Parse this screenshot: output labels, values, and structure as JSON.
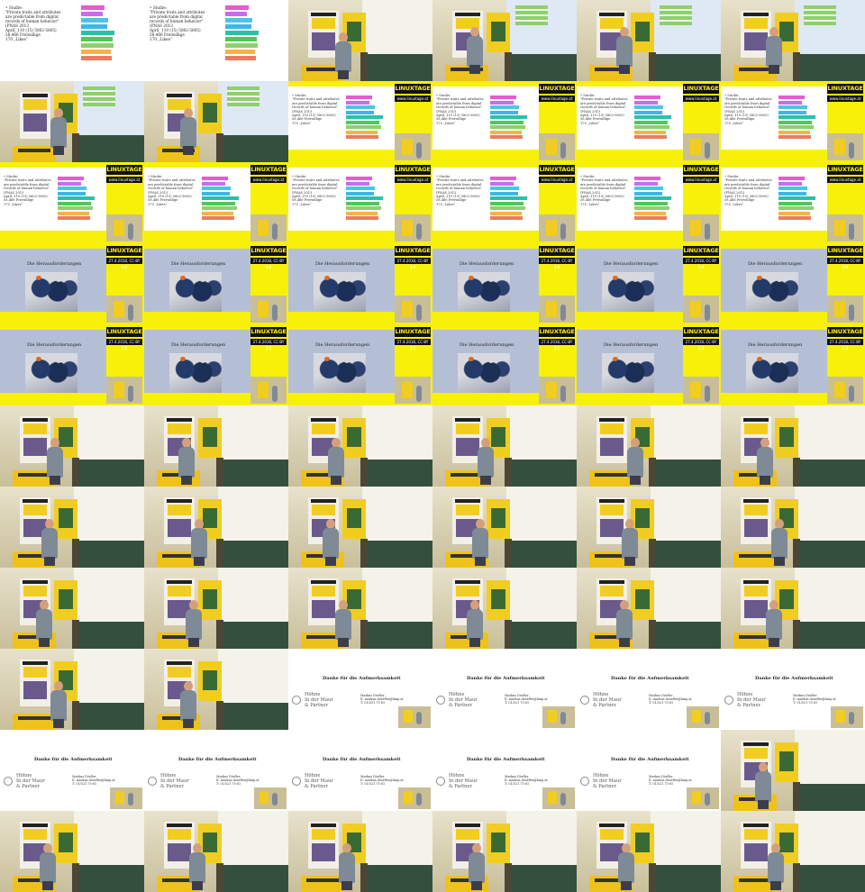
{
  "sheet": {
    "rows": 11,
    "columns": 6
  },
  "slide_intro": {
    "heading": "Studie:",
    "quote": "\"Private traits and attributes are predictable from digital records of human behavior\"",
    "source": "(PNAS 2013",
    "date": "April, 110 (15) 5802-5805)",
    "accuracy": "58,466 Freiwillige",
    "likes": "170 „Likes“"
  },
  "logo_text": "LINUXTAGE",
  "url_text": "www.linuxtage.at",
  "license_text": "27.4.2018, CC-BY 3.0",
  "photo_slide_title": "Die Herausforderungen",
  "thanks": {
    "title": "Danke für die Aufmerksamkeit",
    "firm_line1": "Höhne",
    "firm_line2": "In der Maur",
    "firm_line3": "& Partner",
    "firm_sub": "Rechtsanwälte",
    "name": "Markus Dörfler",
    "email": "E: markus.doerfler@hmp.at",
    "phone": "T: 01/521 75-61"
  },
  "bar_colors": [
    "#e85ad0",
    "#c66cf0",
    "#48c6e8",
    "#3fb6e6",
    "#2cc0a8",
    "#4fc75a",
    "#8ed06e",
    "#f3b24a",
    "#f07a5c"
  ],
  "frame_layout": [
    "plain",
    "plain",
    "stage",
    "stage-prj",
    "stage-prj",
    "stage-prj",
    "stage-prj",
    "stage-prj",
    "slide",
    "slide",
    "slide",
    "slide",
    "slide",
    "slide",
    "slide",
    "slide",
    "slide",
    "slide",
    "photo",
    "photo",
    "photo",
    "photo",
    "photo",
    "photo",
    "photo",
    "photo",
    "photo",
    "photo",
    "photo",
    "photo",
    "stage",
    "stage",
    "stage",
    "stage",
    "stage",
    "stage",
    "stage",
    "stage",
    "stage",
    "stage",
    "stage",
    "stage",
    "stage",
    "stage",
    "stage",
    "stage",
    "stage",
    "stage",
    "stage",
    "stage",
    "thanks",
    "thanks",
    "thanks",
    "thanks",
    "thanks",
    "thanks",
    "thanks",
    "thanks",
    "thanks",
    "stage",
    "stage",
    "stage",
    "stage",
    "stage",
    "stage",
    "stage"
  ]
}
